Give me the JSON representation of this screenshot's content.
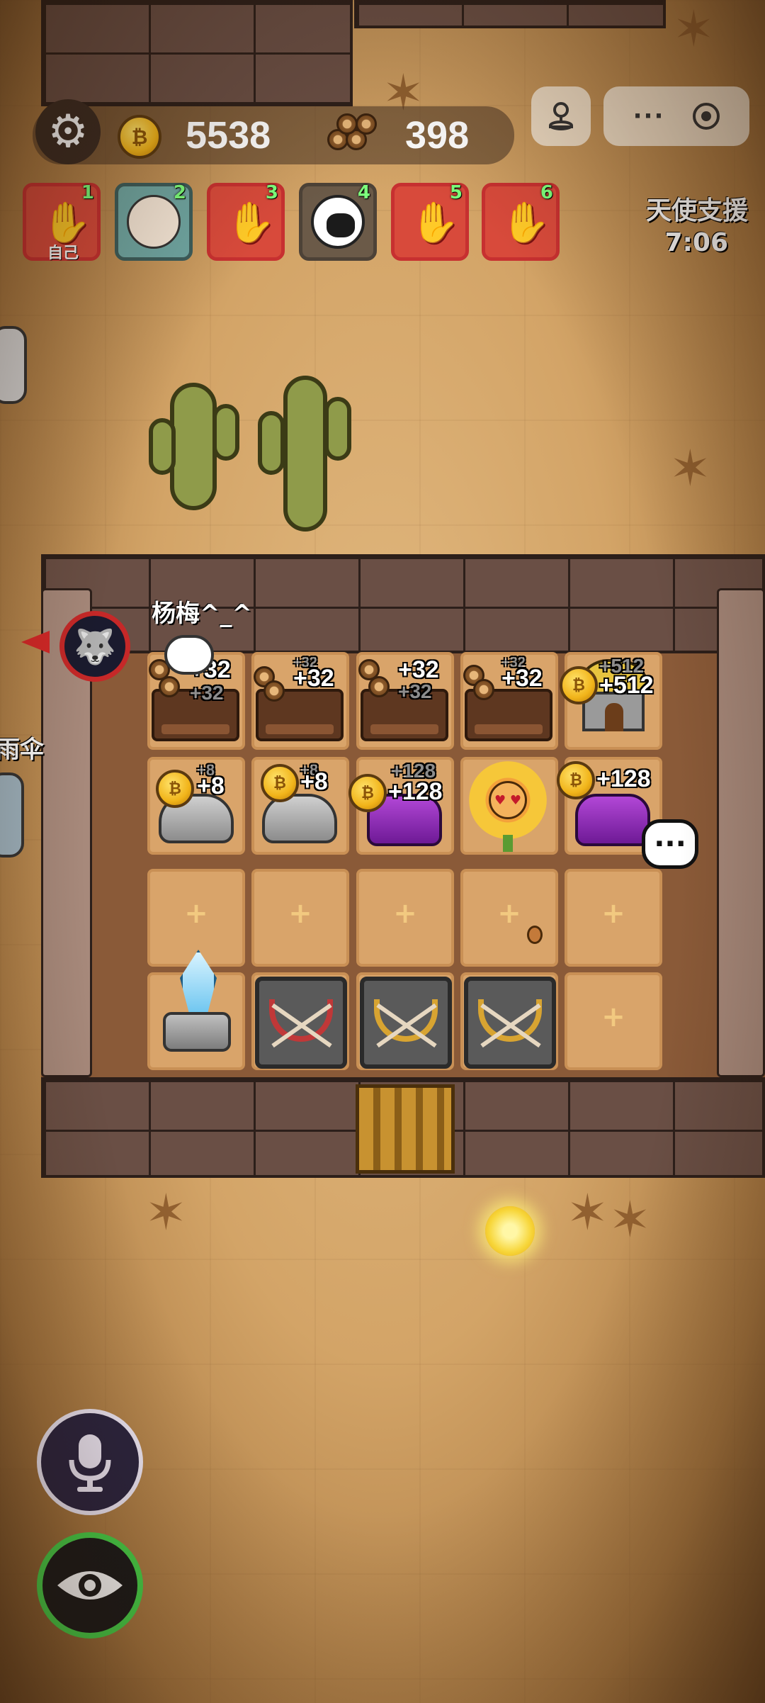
{
  "hud": {
    "coins": "5538",
    "wood": "398"
  },
  "players": [
    {
      "rank": "1",
      "tag": "自己",
      "type": "crab"
    },
    {
      "rank": "2",
      "type": "girl"
    },
    {
      "rank": "3",
      "type": "crab"
    },
    {
      "rank": "4",
      "type": "sheep"
    },
    {
      "rank": "5",
      "type": "crab"
    },
    {
      "rank": "6",
      "type": "crab"
    }
  ],
  "event": {
    "title": "天使支援",
    "timer": "7:06"
  },
  "board": {
    "player_name": "杨梅^_^",
    "side_name": "雨伞",
    "beds": [
      {
        "gain": "+32",
        "ghost": "+32"
      },
      {
        "gain": "+32",
        "ghost": "+32"
      },
      {
        "gain": "+32",
        "ghost": "+32"
      },
      {
        "gain": "+32",
        "ghost": "+32"
      }
    ],
    "hut": {
      "gain": "+512",
      "ghost": "+512"
    },
    "mines": [
      {
        "gain": "+8",
        "ghost": "+8",
        "kind": "rock"
      },
      {
        "gain": "+8",
        "ghost": "+8",
        "kind": "rock"
      },
      {
        "gain": "+128",
        "ghost": "+128",
        "kind": "crystal"
      },
      {
        "gain": "",
        "ghost": "",
        "kind": "sunflower"
      },
      {
        "gain": "+128",
        "ghost": "",
        "kind": "crystal"
      }
    ],
    "chat_icon": "chat-bubble-icon"
  },
  "colors": {
    "wall": "#6a4f45",
    "floor": "#d9a46a",
    "coin": "#f1b41a",
    "mic_ring": "#f0eaf8",
    "eye_ring": "#47d44a"
  }
}
